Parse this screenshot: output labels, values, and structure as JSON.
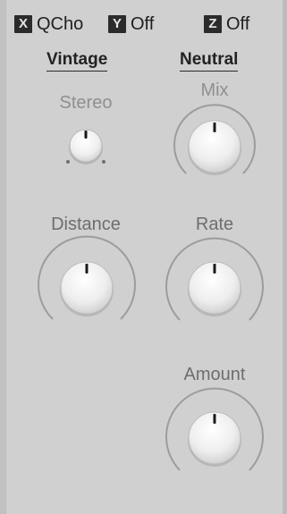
{
  "slots": {
    "x": {
      "key": "X",
      "value": "QCho"
    },
    "y": {
      "key": "Y",
      "value": "Off"
    },
    "z": {
      "key": "Z",
      "value": "Off"
    }
  },
  "voices": {
    "left": "Vintage",
    "right": "Neutral"
  },
  "controls": {
    "stereo": {
      "label": "Stereo",
      "level": 0.5
    },
    "mix": {
      "label": "Mix",
      "level": 0.5
    },
    "distance": {
      "label": "Distance",
      "level": 0.5
    },
    "rate": {
      "label": "Rate",
      "level": 0.5
    },
    "amount": {
      "label": "Amount",
      "level": 0.5
    }
  },
  "colors": {
    "background": "#d0d0d0",
    "knob_face": "#f2f2f2",
    "knob_indicator": "#1a1a1a",
    "arc": "#9c9c9c"
  }
}
